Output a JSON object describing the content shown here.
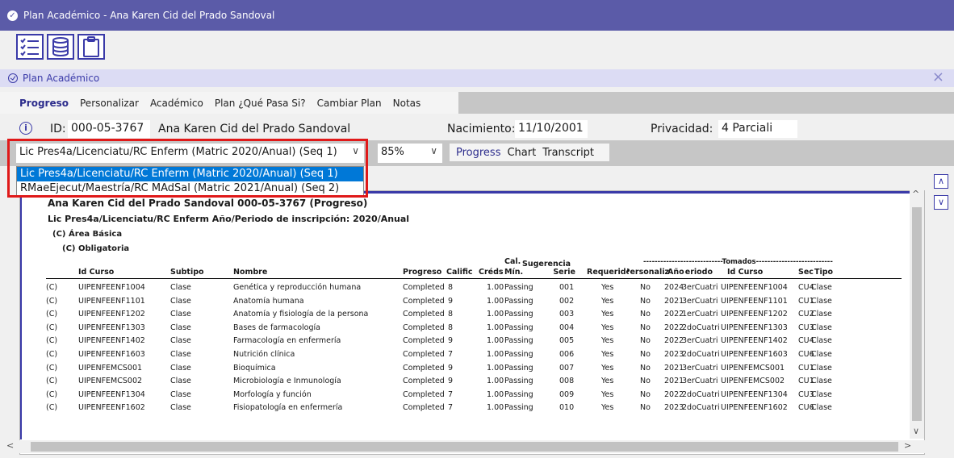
{
  "window": {
    "title": "Plan Académico - Ana Karen Cid del Prado Sandoval"
  },
  "toolbar": {
    "icons": [
      "checklist-icon",
      "database-icon",
      "clipboard-icon"
    ]
  },
  "panel": {
    "title": "Plan Académico",
    "close_label": "×"
  },
  "tabs": [
    "Progreso",
    "Personalizar",
    "Académico",
    "Plan ¿Qué Pasa Si?",
    "Cambiar Plan",
    "Notas"
  ],
  "student": {
    "id_label": "ID:",
    "id_value": "000-05-3767",
    "name": "Ana Karen Cid del Prado Sandoval",
    "birth_label": "Nacimiento:",
    "birth_value": "11/10/2001",
    "privacy_label": "Privacidad:",
    "privacy_value": "4 Parciali"
  },
  "plan_select": {
    "value": "Lic Pres4a/Licenciatu/RC Enferm (Matric 2020/Anual) (Seq 1)",
    "options": [
      "Lic Pres4a/Licenciatu/RC Enferm (Matric 2020/Anual) (Seq 1)",
      "RMaeEjecut/Maestría/RC MAdSal (Matric 2021/Anual) (Seq 2)"
    ]
  },
  "zoom": "85%",
  "view_tabs": [
    "Progress",
    "Chart",
    "Transcript"
  ],
  "report": {
    "heading": "Ana Karen Cid del Prado Sandoval  000-05-3767    (Progreso)",
    "program": "Lic Pres4a/Licenciatu/RC Enferm   Año/Periodo de inscripción: 2020/Anual",
    "area": "(C) Área Básica",
    "sub": "(C) Obligatoria",
    "col": {
      "id": "Id Curso",
      "subtipo": "Subtipo",
      "nombre": "Nombre",
      "progreso": "Progreso",
      "calif": "Calific",
      "creds": "Créds",
      "calmin_top": "Cal.",
      "calmin": "Mín.",
      "sug_top": "Sugerencia",
      "sug": "Serie",
      "req": "Requerido",
      "pers": "Personaliz",
      "tomados": "----------------------------Tomados---------------------------",
      "anio": "Año",
      "periodo": "Periodo",
      "id2": "Id Curso",
      "sec": "Sec",
      "tipo": "Tipo"
    },
    "rows": [
      {
        "s": "(C)",
        "id": "UIPENFEENF1004",
        "sub": "Clase",
        "nom": "Genética y reproducción humana",
        "prog": "Completed",
        "cal": "8",
        "cr": "1.00",
        "min": "Passing",
        "ser": "001",
        "req": "Yes",
        "per": "No",
        "yr": "2024",
        "pd": "3erCuatri",
        "id2": "UIPENFEENF1004",
        "sec": "CU4",
        "tp": "Clase"
      },
      {
        "s": "(C)",
        "id": "UIPENFEENF1101",
        "sub": "Clase",
        "nom": "Anatomía humana",
        "prog": "Completed",
        "cal": "9",
        "cr": "1.00",
        "min": "Passing",
        "ser": "002",
        "req": "Yes",
        "per": "No",
        "yr": "2021",
        "pd": "3erCuatri",
        "id2": "UIPENFEENF1101",
        "sec": "CU1",
        "tp": "Clase"
      },
      {
        "s": "(C)",
        "id": "UIPENFEENF1202",
        "sub": "Clase",
        "nom": "Anatomía y fisiología de la persona",
        "prog": "Completed",
        "cal": "8",
        "cr": "1.00",
        "min": "Passing",
        "ser": "003",
        "req": "Yes",
        "per": "No",
        "yr": "2022",
        "pd": "1erCuatri",
        "id2": "UIPENFEENF1202",
        "sec": "CU2",
        "tp": "Clase"
      },
      {
        "s": "(C)",
        "id": "UIPENFEENF1303",
        "sub": "Clase",
        "nom": "Bases de farmacología",
        "prog": "Completed",
        "cal": "8",
        "cr": "1.00",
        "min": "Passing",
        "ser": "004",
        "req": "Yes",
        "per": "No",
        "yr": "2022",
        "pd": "2doCuatri",
        "id2": "UIPENFEENF1303",
        "sec": "CU3",
        "tp": "Clase"
      },
      {
        "s": "(C)",
        "id": "UIPENFEENF1402",
        "sub": "Clase",
        "nom": "Farmacología en enfermería",
        "prog": "Completed",
        "cal": "9",
        "cr": "1.00",
        "min": "Passing",
        "ser": "005",
        "req": "Yes",
        "per": "No",
        "yr": "2022",
        "pd": "3erCuatri",
        "id2": "UIPENFEENF1402",
        "sec": "CU4",
        "tp": "Clase"
      },
      {
        "s": "(C)",
        "id": "UIPENFEENF1603",
        "sub": "Clase",
        "nom": "Nutrición clínica",
        "prog": "Completed",
        "cal": "7",
        "cr": "1.00",
        "min": "Passing",
        "ser": "006",
        "req": "Yes",
        "per": "No",
        "yr": "2023",
        "pd": "2doCuatri",
        "id2": "UIPENFEENF1603",
        "sec": "CU6",
        "tp": "Clase"
      },
      {
        "s": "(C)",
        "id": "UIPENFEMCS001",
        "sub": "Clase",
        "nom": "Bioquímica",
        "prog": "Completed",
        "cal": "9",
        "cr": "1.00",
        "min": "Passing",
        "ser": "007",
        "req": "Yes",
        "per": "No",
        "yr": "2021",
        "pd": "3erCuatri",
        "id2": "UIPENFEMCS001",
        "sec": "CU1",
        "tp": "Clase"
      },
      {
        "s": "(C)",
        "id": "UIPENFEMCS002",
        "sub": "Clase",
        "nom": "Microbiología e Inmunología",
        "prog": "Completed",
        "cal": "9",
        "cr": "1.00",
        "min": "Passing",
        "ser": "008",
        "req": "Yes",
        "per": "No",
        "yr": "2021",
        "pd": "3erCuatri",
        "id2": "UIPENFEMCS002",
        "sec": "CU1",
        "tp": "Clase"
      },
      {
        "s": "(C)",
        "id": "UIPENFEENF1304",
        "sub": "Clase",
        "nom": "Morfología y función",
        "prog": "Completed",
        "cal": "7",
        "cr": "1.00",
        "min": "Passing",
        "ser": "009",
        "req": "Yes",
        "per": "No",
        "yr": "2022",
        "pd": "2doCuatri",
        "id2": "UIPENFEENF1304",
        "sec": "CU3",
        "tp": "Clase"
      },
      {
        "s": "(C)",
        "id": "UIPENFEENF1602",
        "sub": "Clase",
        "nom": "Fisiopatología en enfermería",
        "prog": "Completed",
        "cal": "7",
        "cr": "1.00",
        "min": "Passing",
        "ser": "010",
        "req": "Yes",
        "per": "No",
        "yr": "2023",
        "pd": "2doCuatri",
        "id2": "UIPENFEENF1602",
        "sec": "CU6",
        "tp": "Clase"
      }
    ]
  },
  "colors": {
    "brand": "#5b5ba8",
    "accent": "#3a3aa8",
    "highlight": "#0078d7",
    "annotation": "#e01919"
  }
}
